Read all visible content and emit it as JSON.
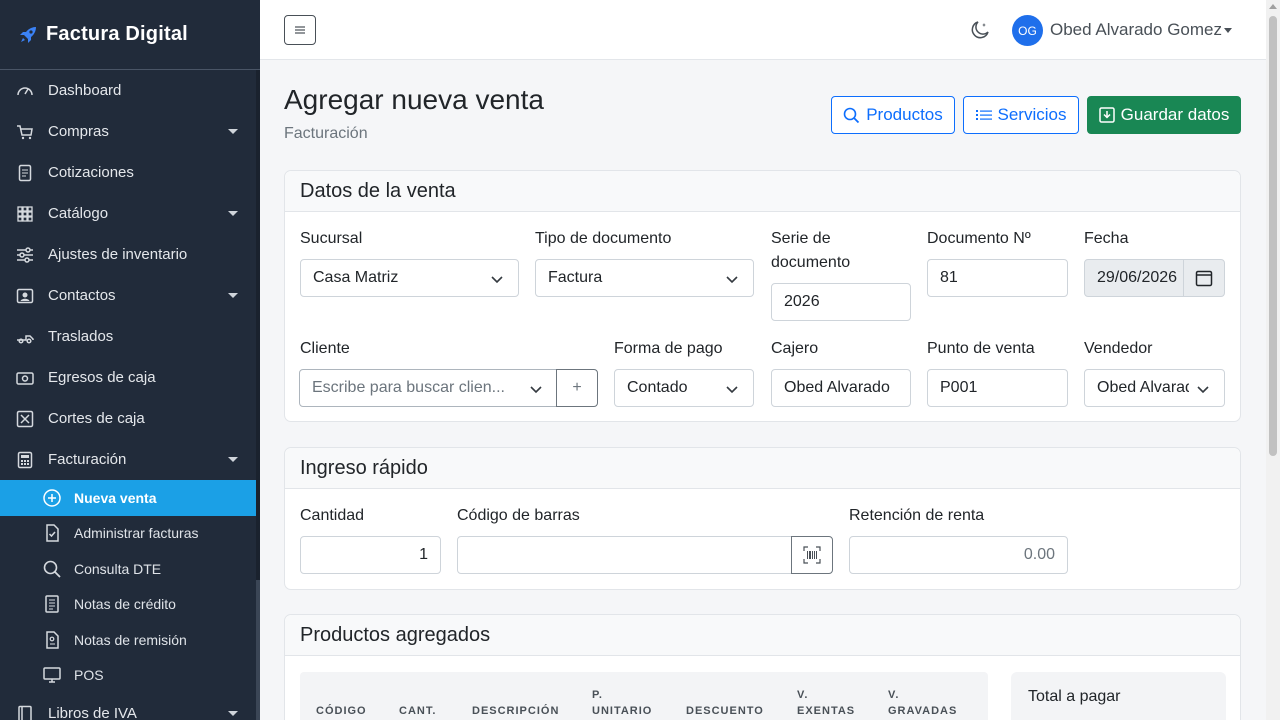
{
  "app": {
    "brand": "Factura Digital"
  },
  "sidebar": {
    "items": [
      {
        "label": "Dashboard",
        "icon": "gauge-icon",
        "caret": false
      },
      {
        "label": "Compras",
        "icon": "cart-icon",
        "caret": true
      },
      {
        "label": "Cotizaciones",
        "icon": "document-icon",
        "caret": false
      },
      {
        "label": "Catálogo",
        "icon": "grid-icon",
        "caret": true
      },
      {
        "label": "Ajustes de inventario",
        "icon": "sliders-icon",
        "caret": false
      },
      {
        "label": "Contactos",
        "icon": "contact-icon",
        "caret": true
      },
      {
        "label": "Traslados",
        "icon": "truck-icon",
        "caret": false
      },
      {
        "label": "Egresos de caja",
        "icon": "cash-icon",
        "caret": false
      },
      {
        "label": "Cortes de caja",
        "icon": "register-icon",
        "caret": false
      },
      {
        "label": "Facturación",
        "icon": "invoice-icon",
        "caret": true
      }
    ],
    "subitems": [
      {
        "label": "Nueva venta",
        "icon": "plus-circle-icon",
        "active": true
      },
      {
        "label": "Administrar facturas",
        "icon": "file-check-icon",
        "active": false
      },
      {
        "label": "Consulta DTE",
        "icon": "search-icon",
        "active": false
      },
      {
        "label": "Notas de crédito",
        "icon": "receipt-icon",
        "active": false
      },
      {
        "label": "Notas de remisión",
        "icon": "file-note-icon",
        "active": false
      },
      {
        "label": "POS",
        "icon": "monitor-icon",
        "active": false
      }
    ],
    "last_item": {
      "label": "Libros de IVA",
      "icon": "book-icon"
    }
  },
  "topbar": {
    "user_initials": "OG",
    "user_name": "Obed Alvarado Gomez"
  },
  "header": {
    "title": "Agregar nueva venta",
    "subtitle": "Facturación",
    "products_label": "Productos",
    "services_label": "Servicios",
    "save_label": "Guardar datos"
  },
  "sale": {
    "card_title": "Datos de la venta",
    "branch": {
      "label": "Sucursal",
      "value": "Casa Matriz"
    },
    "doc_type": {
      "label": "Tipo de documento",
      "value": "Factura"
    },
    "series": {
      "label_line1": "Serie de",
      "label_line2": "documento",
      "value": "2026"
    },
    "doc_number": {
      "label": "Documento Nº",
      "value": "81"
    },
    "date": {
      "label": "Fecha",
      "value": "29/06/2026"
    },
    "client": {
      "label": "Cliente",
      "placeholder": "Escribe para buscar clien..."
    },
    "payment": {
      "label": "Forma de pago",
      "value": "Contado"
    },
    "cashier": {
      "label": "Cajero",
      "value": "Obed Alvarado"
    },
    "pos": {
      "label": "Punto de venta",
      "value": "P001"
    },
    "seller": {
      "label": "Vendedor",
      "value": "Obed Alvarado"
    }
  },
  "quick": {
    "card_title": "Ingreso rápido",
    "quantity": {
      "label": "Cantidad",
      "value": "1"
    },
    "barcode": {
      "label": "Código de barras",
      "value": ""
    },
    "retention": {
      "label": "Retención de renta",
      "value": "0.00"
    }
  },
  "products": {
    "card_title": "Productos agregados",
    "columns": [
      {
        "line1": "",
        "line2": "CÓDIGO"
      },
      {
        "line1": "",
        "line2": "CANT."
      },
      {
        "line1": "",
        "line2": "DESCRIPCIÓN"
      },
      {
        "line1": "P.",
        "line2": "UNITARIO"
      },
      {
        "line1": "",
        "line2": "DESCUENTO"
      },
      {
        "line1": "V.",
        "line2": "EXENTAS"
      },
      {
        "line1": "V.",
        "line2": "GRAVADAS"
      }
    ],
    "total_label": "Total a pagar"
  },
  "colors": {
    "sidebar_bg": "#212b3a",
    "active_bg": "#1ba0e6",
    "primary": "#0d6efd",
    "success": "#198754"
  }
}
